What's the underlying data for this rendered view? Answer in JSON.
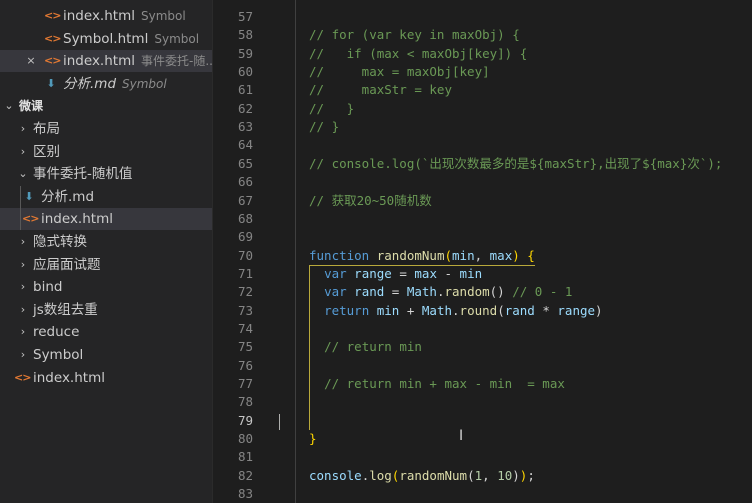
{
  "open_editors": [
    {
      "name": "index.html",
      "desc": "Symbol",
      "icon": "html-icon"
    },
    {
      "name": "Symbol.html",
      "desc": "Symbol",
      "icon": "html-icon"
    },
    {
      "name": "index.html",
      "desc": "事件委托-随...",
      "icon": "html-icon",
      "close": "×"
    },
    {
      "name": "分析.md",
      "desc": "Symbol",
      "icon": "md-icon"
    }
  ],
  "explorer": {
    "root": "微课",
    "items": [
      {
        "label": "布局",
        "type": "folder",
        "chev": "›"
      },
      {
        "label": "区别",
        "type": "folder",
        "chev": "›"
      },
      {
        "label": "事件委托-随机值",
        "type": "folder-open",
        "chev": "⌄"
      },
      {
        "label": "分析.md",
        "type": "file-md"
      },
      {
        "label": "index.html",
        "type": "file-html"
      },
      {
        "label": "隐式转换",
        "type": "folder",
        "chev": "›"
      },
      {
        "label": "应届面试题",
        "type": "folder",
        "chev": "›"
      },
      {
        "label": "bind",
        "type": "folder",
        "chev": "›"
      },
      {
        "label": "js数组去重",
        "type": "folder",
        "chev": "›"
      },
      {
        "label": "reduce",
        "type": "folder",
        "chev": "›"
      },
      {
        "label": "Symbol",
        "type": "folder",
        "chev": "›"
      },
      {
        "label": "index.html",
        "type": "file-html"
      }
    ]
  },
  "icons": {
    "html": "<>",
    "md": "⬇",
    "root_chev": "⌄"
  },
  "editor": {
    "line_numbers": [
      "57",
      "58",
      "59",
      "60",
      "61",
      "62",
      "63",
      "64",
      "65",
      "66",
      "67",
      "68",
      "69",
      "70",
      "71",
      "72",
      "73",
      "74",
      "75",
      "76",
      "77",
      "78",
      "79",
      "80",
      "81",
      "82",
      "83"
    ],
    "current_line": "79",
    "lines": [
      [],
      [
        [
          "cm",
          "// for (var key in maxObj) {"
        ]
      ],
      [
        [
          "cm",
          "//   if (max < maxObj[key]) {"
        ]
      ],
      [
        [
          "cm",
          "//     max = maxObj[key]"
        ]
      ],
      [
        [
          "cm",
          "//     maxStr = key"
        ]
      ],
      [
        [
          "cm",
          "//   }"
        ]
      ],
      [
        [
          "cm",
          "// }"
        ]
      ],
      [],
      [
        [
          "cm",
          "// console.log(`出现次数最多的是${maxStr},出现了${max}次`);"
        ]
      ],
      [],
      [
        [
          "cm",
          "// 获取20~50随机数"
        ]
      ],
      [],
      [],
      [
        [
          "kw",
          "function"
        ],
        [
          "plain",
          " "
        ],
        [
          "fn",
          "randomNum"
        ],
        [
          "br",
          "("
        ],
        [
          "var",
          "min"
        ],
        [
          "plain",
          ", "
        ],
        [
          "var",
          "max"
        ],
        [
          "br",
          ")"
        ],
        [
          "plain",
          " "
        ],
        [
          "br",
          "{"
        ]
      ],
      [
        [
          "plain",
          "  "
        ],
        [
          "kw",
          "var"
        ],
        [
          "plain",
          " "
        ],
        [
          "var",
          "range"
        ],
        [
          "plain",
          " = "
        ],
        [
          "var",
          "max"
        ],
        [
          "plain",
          " - "
        ],
        [
          "var",
          "min"
        ]
      ],
      [
        [
          "plain",
          "  "
        ],
        [
          "kw",
          "var"
        ],
        [
          "plain",
          " "
        ],
        [
          "var",
          "rand"
        ],
        [
          "plain",
          " = "
        ],
        [
          "var",
          "Math"
        ],
        [
          "plain",
          "."
        ],
        [
          "fn",
          "random"
        ],
        [
          "plain",
          "() "
        ],
        [
          "cm",
          "// 0 - 1"
        ]
      ],
      [
        [
          "plain",
          "  "
        ],
        [
          "kw",
          "return"
        ],
        [
          "plain",
          " "
        ],
        [
          "var",
          "min"
        ],
        [
          "plain",
          " + "
        ],
        [
          "var",
          "Math"
        ],
        [
          "plain",
          "."
        ],
        [
          "fn",
          "round"
        ],
        [
          "plain",
          "("
        ],
        [
          "var",
          "rand"
        ],
        [
          "plain",
          " * "
        ],
        [
          "var",
          "range"
        ],
        [
          "plain",
          ")"
        ]
      ],
      [],
      [
        [
          "plain",
          "  "
        ],
        [
          "cm",
          "// return min"
        ]
      ],
      [],
      [
        [
          "plain",
          "  "
        ],
        [
          "cm",
          "// return min + max - min  = max"
        ]
      ],
      [],
      [],
      [
        [
          "br",
          "}"
        ]
      ],
      [],
      [
        [
          "var",
          "console"
        ],
        [
          "plain",
          "."
        ],
        [
          "fn",
          "log"
        ],
        [
          "br",
          "("
        ],
        [
          "fn",
          "randomNum"
        ],
        [
          "plain",
          "("
        ],
        [
          "num",
          "1"
        ],
        [
          "plain",
          ", "
        ],
        [
          "num",
          "10"
        ],
        [
          "plain",
          ")"
        ],
        [
          "br",
          ")"
        ],
        [
          "plain",
          ";"
        ]
      ],
      []
    ]
  }
}
